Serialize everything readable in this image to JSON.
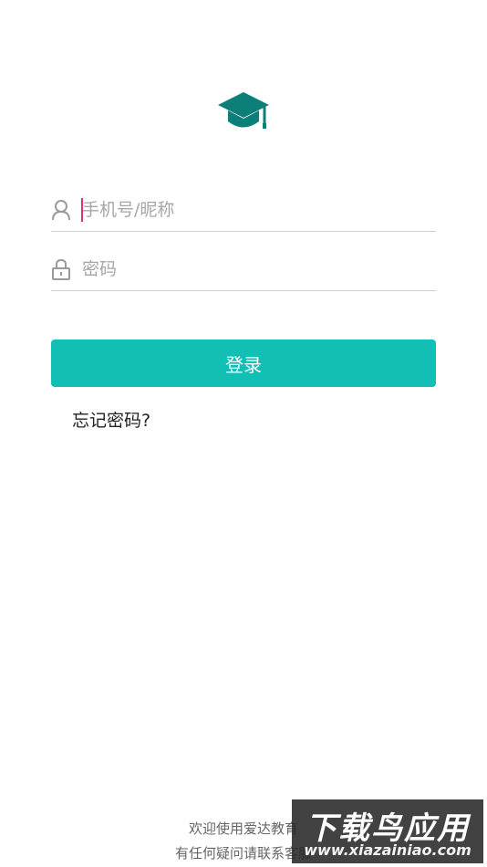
{
  "logo": {
    "icon": "graduation-cap-icon",
    "color": "#0b7f78"
  },
  "form": {
    "username": {
      "icon": "user-icon",
      "placeholder": "手机号/昵称",
      "value": ""
    },
    "password": {
      "icon": "lock-icon",
      "placeholder": "密码",
      "value": ""
    }
  },
  "login_button": {
    "label": "登录",
    "color": "#12bfb4"
  },
  "forgot_password": {
    "label": "忘记密码?"
  },
  "footer": {
    "line1": "欢迎使用爱达教育",
    "line2": "有任何疑问请联系客服"
  },
  "watermark": {
    "title": "下载鸟应用",
    "url": "www.xiazainiao.com"
  }
}
